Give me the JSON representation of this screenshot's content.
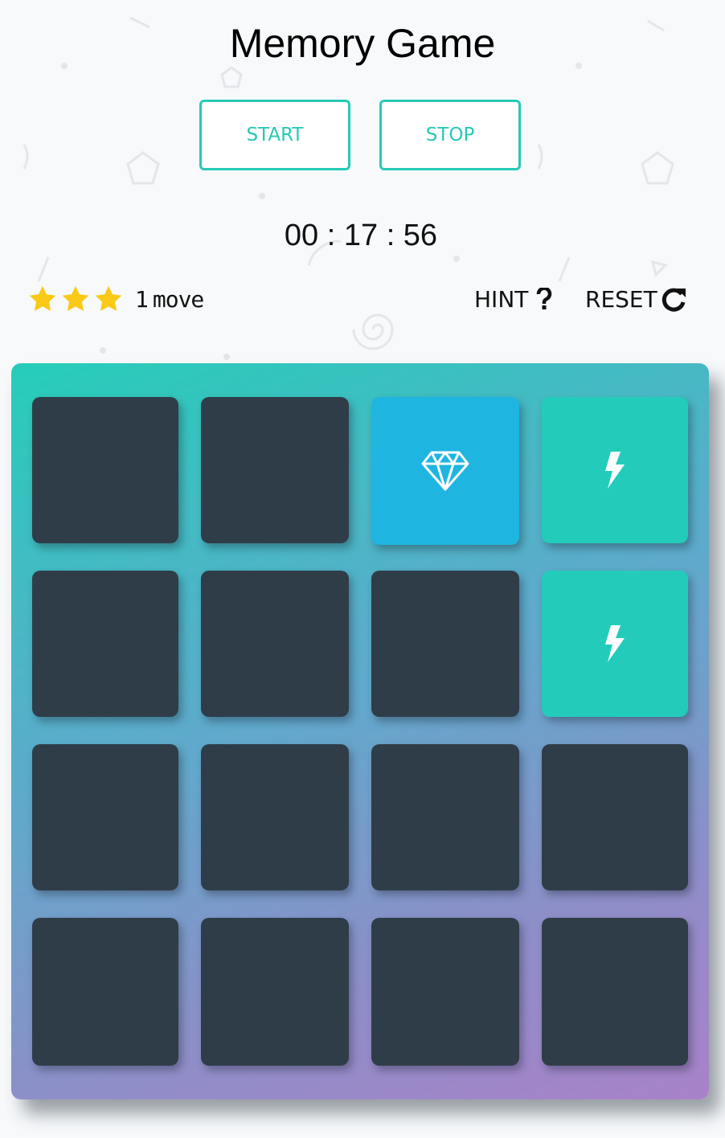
{
  "title": "Memory Game",
  "controls": {
    "start_label": "START",
    "stop_label": "STOP"
  },
  "timer": "00 : 17 : 56",
  "score": {
    "stars": 3,
    "star_color": "#f9c915",
    "moves_count": "1",
    "moves_label": "move"
  },
  "actions": {
    "hint_label": "HINT",
    "hint_icon": "question-mark-icon",
    "reset_label": "RESET",
    "reset_icon": "redo-icon"
  },
  "colors": {
    "accent": "#27c9b7",
    "card_back": "#2f3d48",
    "card_open_blue": "#1fb5e1",
    "card_open_green": "#23ccba"
  },
  "board": {
    "rows": 4,
    "cols": 4,
    "cards": [
      {
        "state": "hidden",
        "icon": ""
      },
      {
        "state": "hidden",
        "icon": ""
      },
      {
        "state": "open",
        "icon": "diamond-icon",
        "color": "blue"
      },
      {
        "state": "matched",
        "icon": "bolt-icon",
        "color": "green"
      },
      {
        "state": "hidden",
        "icon": ""
      },
      {
        "state": "hidden",
        "icon": ""
      },
      {
        "state": "hidden",
        "icon": ""
      },
      {
        "state": "matched",
        "icon": "bolt-icon",
        "color": "green"
      },
      {
        "state": "hidden",
        "icon": ""
      },
      {
        "state": "hidden",
        "icon": ""
      },
      {
        "state": "hidden",
        "icon": ""
      },
      {
        "state": "hidden",
        "icon": ""
      },
      {
        "state": "hidden",
        "icon": ""
      },
      {
        "state": "hidden",
        "icon": ""
      },
      {
        "state": "hidden",
        "icon": ""
      },
      {
        "state": "hidden",
        "icon": ""
      }
    ]
  }
}
